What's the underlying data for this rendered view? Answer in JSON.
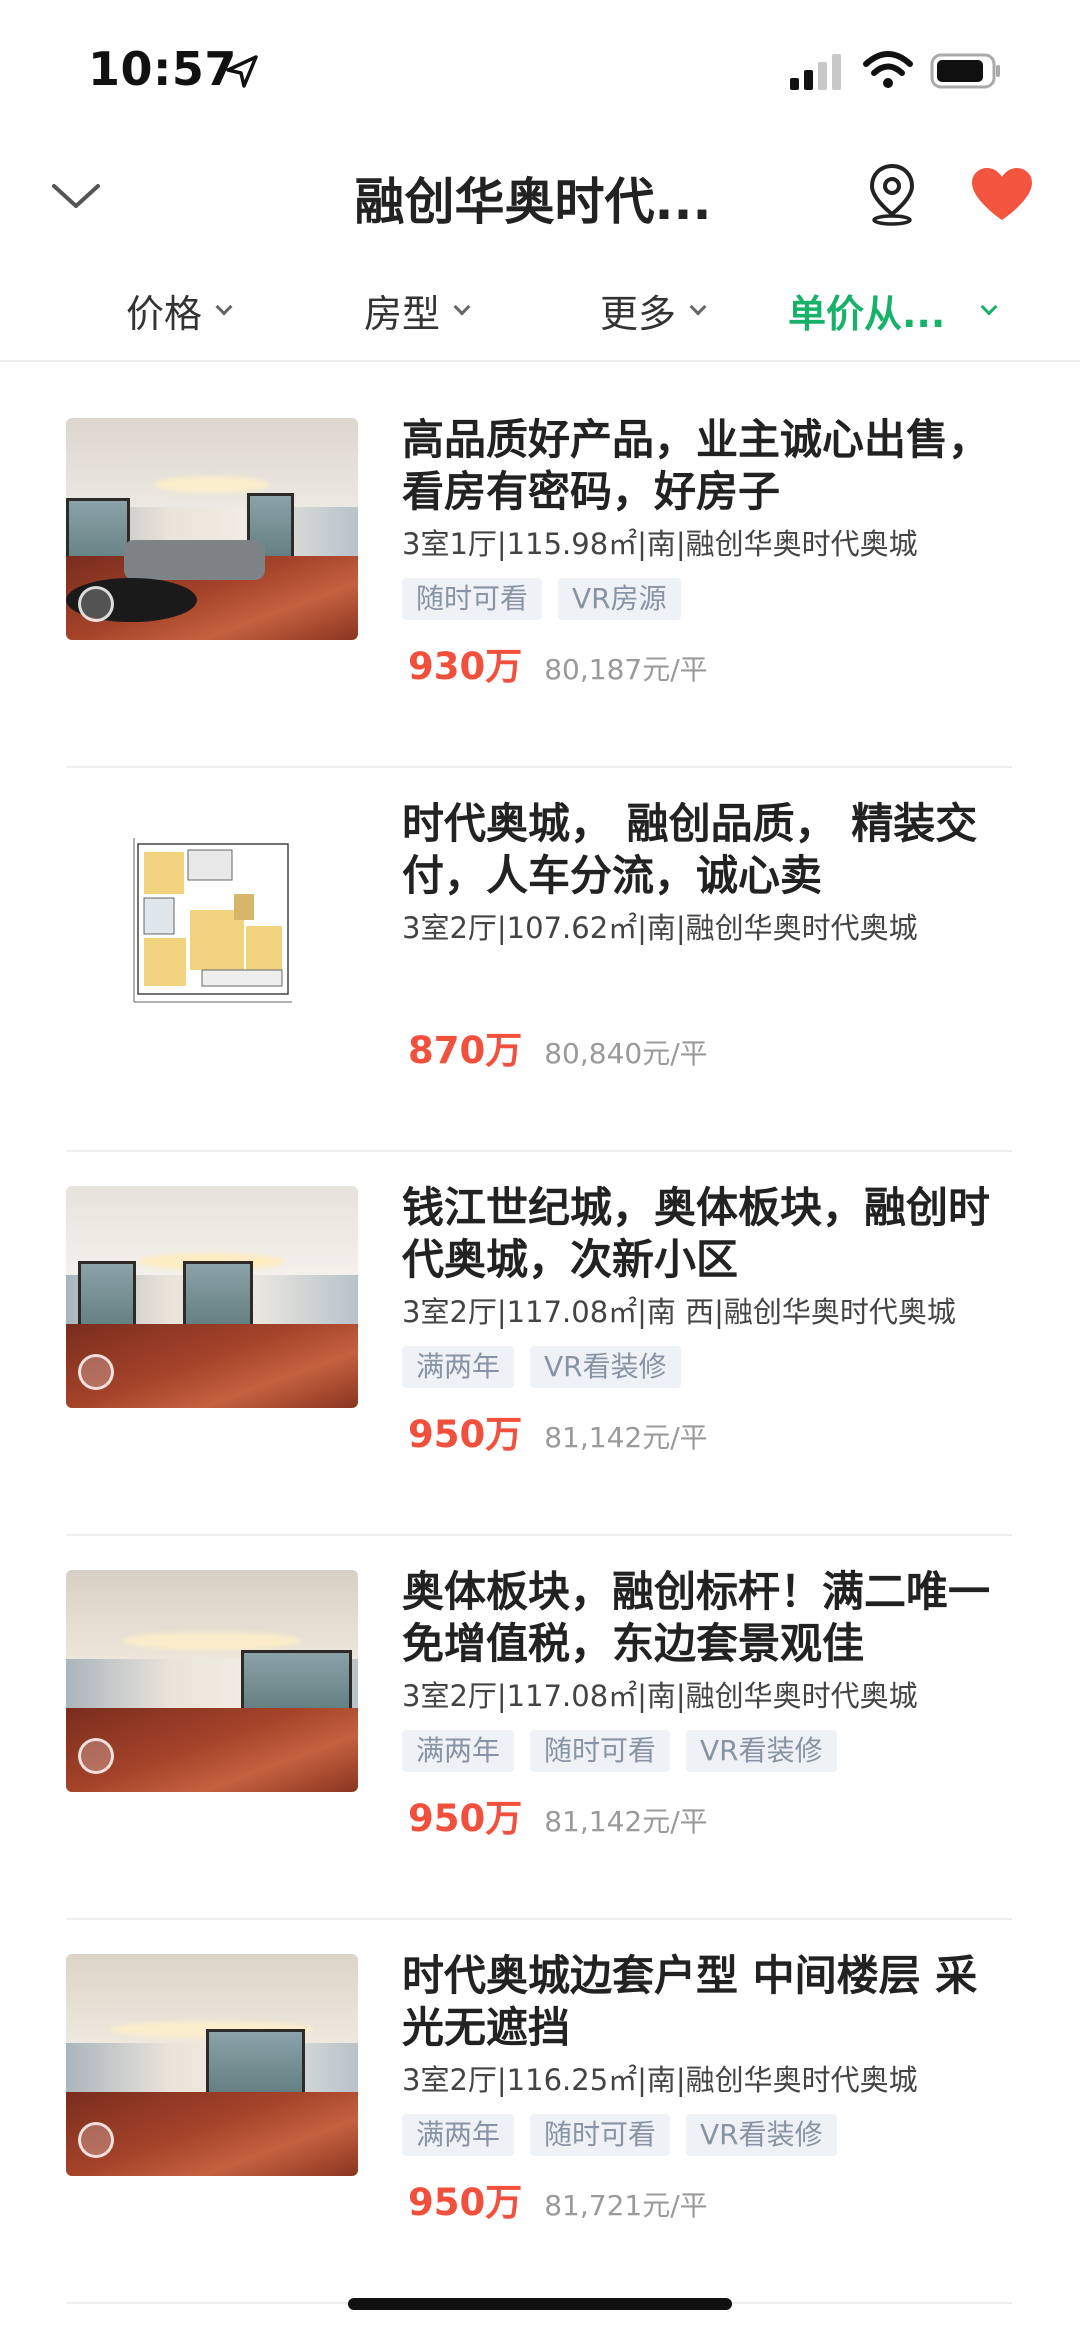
{
  "status": {
    "time": "10:57"
  },
  "nav": {
    "title": "融创华奥时代..."
  },
  "filters": [
    {
      "label": "价格"
    },
    {
      "label": "房型"
    },
    {
      "label": "更多"
    },
    {
      "label": "单价从..."
    }
  ],
  "listings": [
    {
      "title": "高品质好产品，业主诚心出售，看房有密码，好房子",
      "spec": "3室1厅|115.98㎡|南|融创华奥时代奥城",
      "tags": [
        "随时可看",
        "VR房源"
      ],
      "price": "930万",
      "unit_price": "80,187元/平"
    },
    {
      "title": "时代奥城， 融创品质， 精装交付，人车分流，诚心卖",
      "spec": "3室2厅|107.62㎡|南|融创华奥时代奥城",
      "tags": [],
      "price": "870万",
      "unit_price": "80,840元/平"
    },
    {
      "title": "钱江世纪城，奥体板块，融创时代奥城，次新小区",
      "spec": "3室2厅|117.08㎡|南 西|融创华奥时代奥城",
      "tags": [
        "满两年",
        "VR看装修"
      ],
      "price": "950万",
      "unit_price": "81,142元/平"
    },
    {
      "title": "奥体板块，融创标杆！满二唯一免增值税，东边套景观佳",
      "spec": "3室2厅|117.08㎡|南|融创华奥时代奥城",
      "tags": [
        "满两年",
        "随时可看",
        "VR看装修"
      ],
      "price": "950万",
      "unit_price": "81,142元/平"
    },
    {
      "title": "时代奥城边套户型 中间楼层 采光无遮挡",
      "spec": "3室2厅|116.25㎡|南|融创华奥时代奥城",
      "tags": [
        "满两年",
        "随时可看",
        "VR看装修"
      ],
      "price": "950万",
      "unit_price": "81,721元/平"
    }
  ]
}
